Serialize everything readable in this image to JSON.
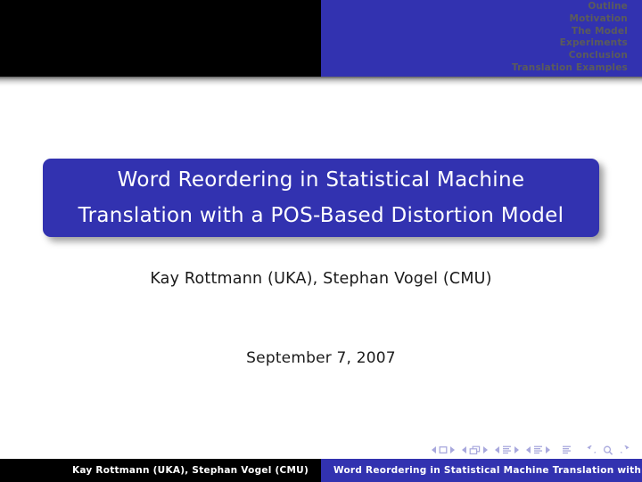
{
  "slide": {
    "type": "beamer-title-slide",
    "background_color": "#ffffff",
    "accent_color": "#3232b0",
    "header_bar_color": "#000000",
    "nav_inactive_color": "#5b5b5b"
  },
  "header": {
    "sections": [
      {
        "label": "Outline"
      },
      {
        "label": "Motivation"
      },
      {
        "label": "The Model"
      },
      {
        "label": "Experiments"
      },
      {
        "label": "Conclusion"
      },
      {
        "label": "Translation Examples"
      }
    ]
  },
  "title": {
    "line1": "Word Reordering in Statistical Machine",
    "line2": "Translation with a POS-Based Distortion Model",
    "full": "Word Reordering in Statistical Machine Translation with a POS-Based Distortion Model"
  },
  "authors": "Kay Rottmann (UKA), Stephan Vogel (CMU)",
  "date": "September 7, 2007",
  "footer": {
    "left": "Kay Rottmann (UKA), Stephan Vogel (CMU)",
    "right": "Word Reordering in Statistical Machine Translation with a POS-Based Distortion Model"
  },
  "navigation_symbols": {
    "groups": [
      {
        "prev": "◂",
        "icon": "slide-icon",
        "next": "▸"
      },
      {
        "prev": "◂",
        "icon": "frame-icon",
        "next": "▸"
      },
      {
        "prev": "◂",
        "icon": "subsection-icon",
        "next": "▸"
      },
      {
        "prev": "◂",
        "icon": "section-icon",
        "next": "▸"
      }
    ],
    "doc_icon": "document-icon",
    "back_icon": "back-arrow-icon",
    "search_icon": "magnifier-icon",
    "forward_icon": "forward-arrow-icon"
  }
}
